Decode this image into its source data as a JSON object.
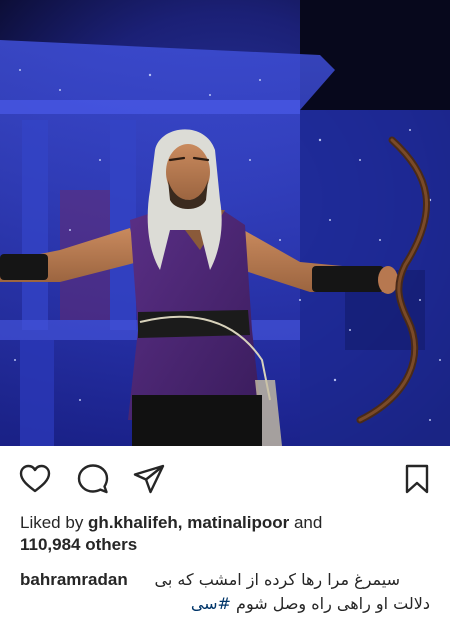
{
  "post": {
    "image_alt": "Stage actor with white hair holding a bow in purple costume",
    "icons": {
      "like": "heart-icon",
      "comment": "comment-bubble-icon",
      "share": "paper-plane-icon",
      "save": "bookmark-icon"
    },
    "likes": {
      "prefix": "Liked by ",
      "user1": "gh.khalifeh",
      "separator": ", ",
      "user2": "matinalipoor",
      "and": " and",
      "count": "110,984 others"
    },
    "caption": {
      "username": "bahramradan",
      "line1": "سیمرغ مرا رها کرده از امشب که بی",
      "line2_text": "دلالت او راهی راه وصل شوم ",
      "hashtag": "#سی"
    }
  }
}
